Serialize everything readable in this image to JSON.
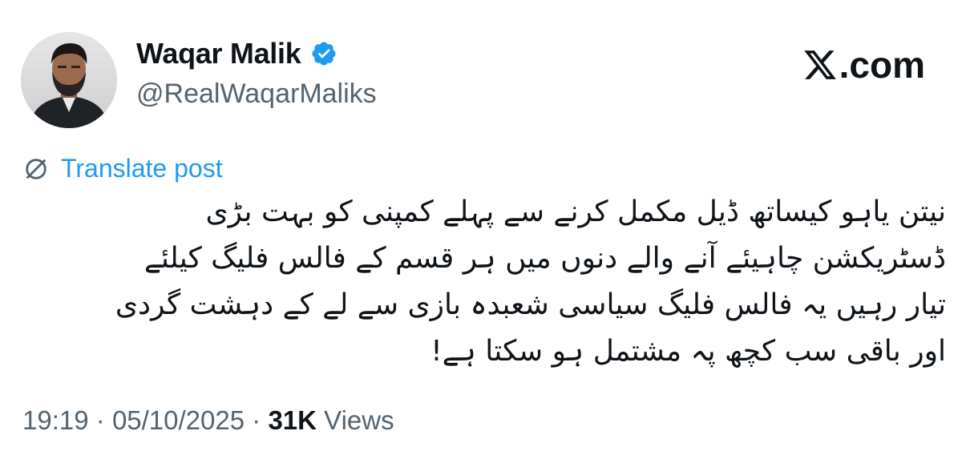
{
  "author": {
    "display_name": "Waqar Malik",
    "handle": "@RealWaqarMaliks",
    "verified": true
  },
  "brand": {
    "label": ".com"
  },
  "translate": {
    "label": "Translate post"
  },
  "tweet": {
    "text": "نیتن یاہو کیساتھ ڈیل مکمل کرنے سے پہلے کمپنی کو بہت بڑی ڈسٹریکشن چاہیئے آنے والے دنوں میں ہر قسم کے فالس فلیگ کیلئے تیار رہیں یہ فالس فلیگ سیاسی شعبدہ بازی سے لے کے دہشت گردی اور باقی سب کچھ پہ مشتمل ہو سکتا ہے!"
  },
  "meta": {
    "time": "19:19",
    "sep1": "·",
    "date": "05/10/2025",
    "sep2": "·",
    "views_count": "31K",
    "views_label": "Views"
  },
  "colors": {
    "link": "#1d9bf0",
    "muted": "#536471",
    "text": "#0f1419",
    "verified_badge": "#1d9bf0"
  },
  "icons": {
    "verified": "verified-badge-icon",
    "brand": "x-logo-icon",
    "translate": "globe-icon"
  }
}
